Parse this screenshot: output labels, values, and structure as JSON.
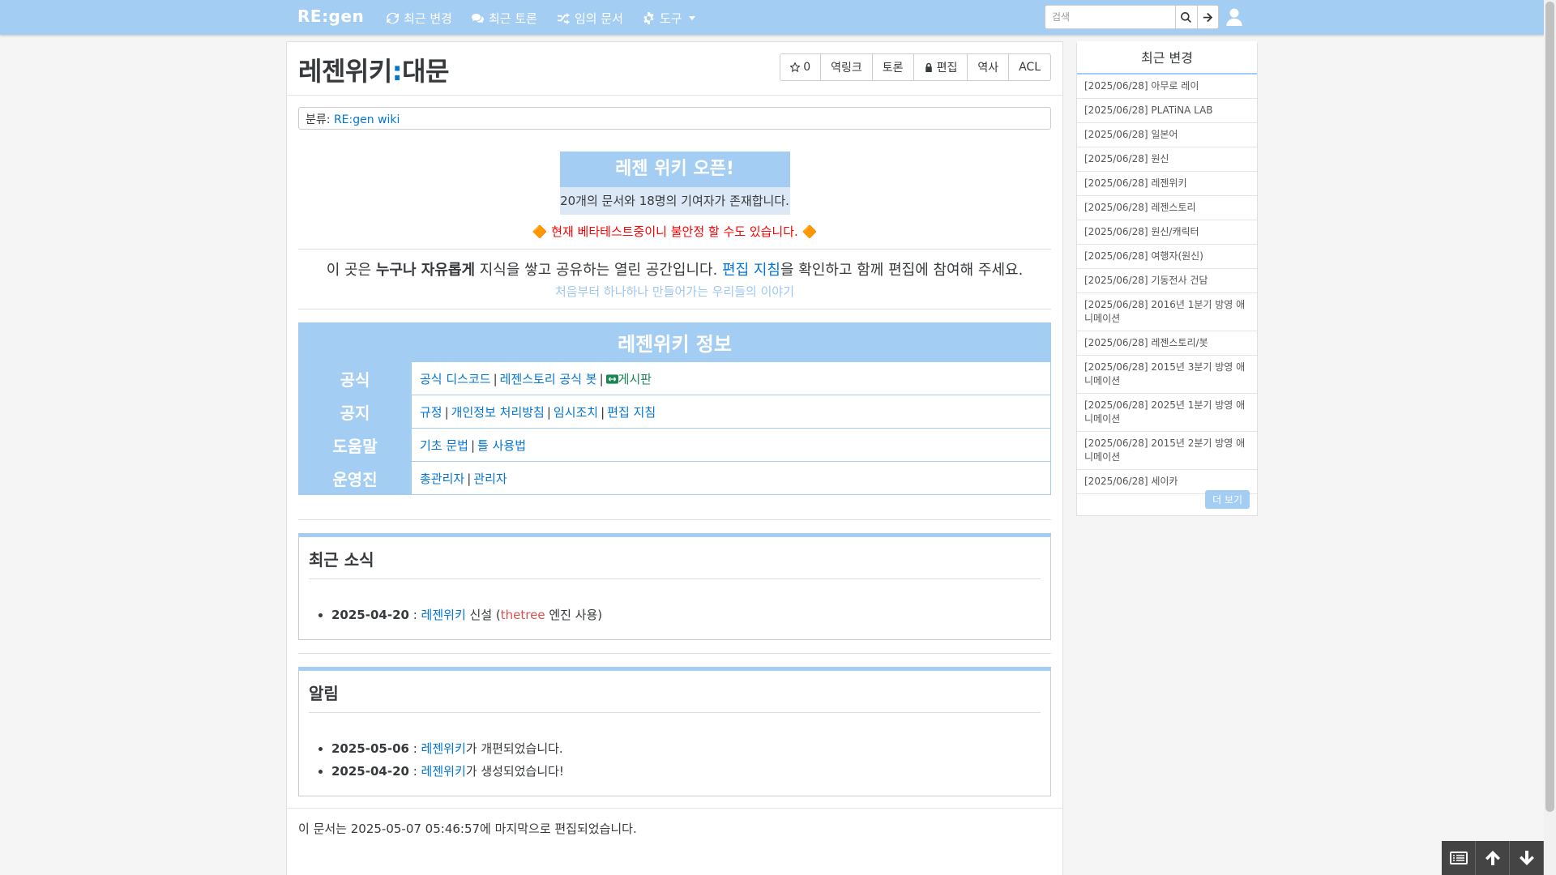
{
  "navbar": {
    "brand": "RE:gen",
    "items": [
      {
        "label": "최근 변경",
        "icon": "refresh-icon"
      },
      {
        "label": "최근 토론",
        "icon": "comments-icon"
      },
      {
        "label": "임의 문서",
        "icon": "random-icon"
      },
      {
        "label": "도구",
        "icon": "gear-icon"
      }
    ],
    "search_placeholder": "검색"
  },
  "page": {
    "title_ns": "레젠위키",
    "title_colon": ":",
    "title_name": "대문",
    "toolbar": {
      "star_count": "0",
      "backlink": "역링크",
      "discuss": "토론",
      "edit": "편집",
      "history": "역사",
      "acl": "ACL"
    },
    "category_label": "분류:",
    "category_link": "RE:gen wiki"
  },
  "banner": {
    "title": "레젠 위키 오픈!",
    "subtitle": "20개의 문서와 18명의 기여자가 존재합니다.",
    "beta_diamond_left": "🔶",
    "beta_text": "현재 베타테스트중이니 불안정 할 수도 있습니다.",
    "beta_diamond_right": "🔶"
  },
  "intro": {
    "pre": "이 곳은 ",
    "bold": "누구나 자유롭게",
    "mid": " 지식을 쌓고 공유하는 열린 공간입니다. ",
    "link": "편집 지침",
    "post": "을 확인하고 함께 편집에 참여해 주세요.",
    "sub": "처음부터 하나하나 만들어가는 우리들의 이야기"
  },
  "info_table": {
    "caption": "레젠위키 정보",
    "rows": [
      {
        "head": "공식",
        "links": [
          "공식 디스코드",
          "레젠스토리 공식 봇"
        ],
        "extra_link": "게시판"
      },
      {
        "head": "공지",
        "links": [
          "규정",
          "개인정보 처리방침",
          "임시조치",
          "편집 지침"
        ]
      },
      {
        "head": "도움말",
        "links": [
          "기초 문법",
          "틀 사용법"
        ]
      },
      {
        "head": "운영진",
        "links": [
          "총관리자",
          "관리자"
        ]
      }
    ],
    "separator": "|"
  },
  "news": {
    "title": "최근 소식",
    "items": [
      {
        "date": "2025-04-20",
        "sep": " : ",
        "link": "레젠위키",
        "text1": " 신설 (",
        "link2": "thetree",
        "text2": " 엔진 사용)"
      }
    ]
  },
  "notice": {
    "title": "알림",
    "items": [
      {
        "date": "2025-05-06",
        "sep": " : ",
        "link": "레젠위키",
        "text": "가 개편되었습니다."
      },
      {
        "date": "2025-04-20",
        "sep": " : ",
        "link": "레젠위키",
        "text": "가 생성되었습니다!"
      }
    ]
  },
  "footer_note": "이 문서는 2025-05-07 05:46:57에 마지막으로 편집되었습니다.",
  "sidebar": {
    "title": "최근 변경",
    "items": [
      "[2025/06/28] 아무로 레이",
      "[2025/06/28] PLATiNA LAB",
      "[2025/06/28] 일본어",
      "[2025/06/28] 원신",
      "[2025/06/28] 레젠위키",
      "[2025/06/28] 레젠스토리",
      "[2025/06/28] 원신/캐릭터",
      "[2025/06/28] 여행자(원신)",
      "[2025/06/28] 기동전사 건담",
      "[2025/06/28] 2016년 1분기 방영 애니메이션",
      "[2025/06/28] 레젠스토리/봇",
      "[2025/06/28] 2015년 3분기 방영 애니메이션",
      "[2025/06/28] 2025년 1분기 방영 애니메이션",
      "[2025/06/28] 2015년 2분기 방영 애니메이션",
      "[2025/06/28] 세이카"
    ],
    "more": "더 보기"
  },
  "colors": {
    "accent": "#a3cdf2",
    "link": "#0275d8",
    "warning": "#ff0000"
  }
}
